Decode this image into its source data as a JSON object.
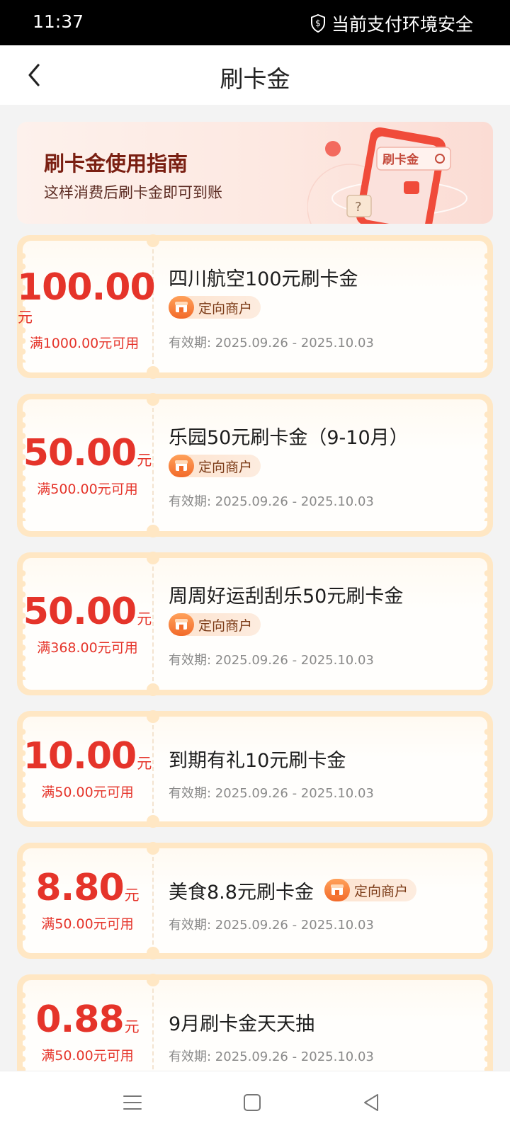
{
  "status_bar": {
    "time": "11:37",
    "security_text": "当前支付环境安全"
  },
  "nav": {
    "title": "刷卡金"
  },
  "guide": {
    "title": "刷卡金使用指南",
    "subtitle": "这样消费后刷卡金即可到账",
    "illustration_label": "刷卡金"
  },
  "coupons": [
    {
      "amount": "100.00",
      "unit": "元",
      "threshold": "满1000.00元可用",
      "title": "四川航空100元刷卡金",
      "tag": "定向商户",
      "validity": "有效期: 2025.09.26 - 2025.10.03"
    },
    {
      "amount": "50.00",
      "unit": "元",
      "threshold": "满500.00元可用",
      "title": "乐园50元刷卡金（9-10月）",
      "tag": "定向商户",
      "validity": "有效期: 2025.09.26 - 2025.10.03"
    },
    {
      "amount": "50.00",
      "unit": "元",
      "threshold": "满368.00元可用",
      "title": "周周好运刮刮乐50元刷卡金",
      "tag": "定向商户",
      "validity": "有效期: 2025.09.26 - 2025.10.03"
    },
    {
      "amount": "10.00",
      "unit": "元",
      "threshold": "满50.00元可用",
      "title": "到期有礼10元刷卡金",
      "validity": "有效期: 2025.09.26 - 2025.10.03"
    },
    {
      "amount": "8.80",
      "unit": "元",
      "threshold": "满50.00元可用",
      "title": "美食8.8元刷卡金",
      "tag": "定向商户",
      "validity": "有效期: 2025.09.26 - 2025.10.03"
    },
    {
      "amount": "0.88",
      "unit": "元",
      "threshold": "满50.00元可用",
      "title": "9月刷卡金天天抽",
      "validity": "有效期: 2025.09.26 - 2025.10.03"
    }
  ],
  "colors": {
    "accent_red": "#e5342a",
    "coupon_border": "#ffe7c4",
    "tag_orange": "#f26a2a"
  },
  "bottom_nav": {
    "icons": [
      "menu-icon",
      "home-square-icon",
      "back-triangle-icon"
    ]
  }
}
